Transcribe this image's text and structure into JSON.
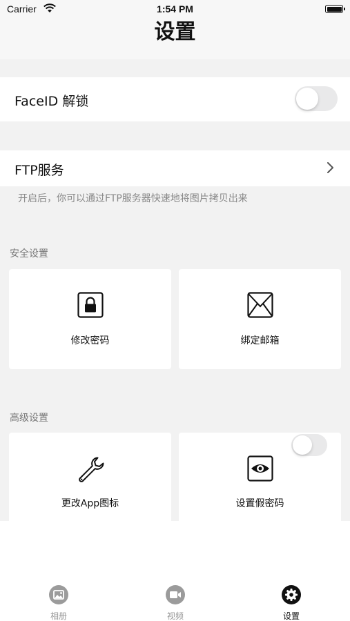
{
  "status_bar": {
    "carrier": "Carrier",
    "time": "1:54 PM"
  },
  "header": {
    "title": "设置"
  },
  "faceid": {
    "label": "FaceID 解锁",
    "enabled": false
  },
  "ftp": {
    "label": "FTP服务",
    "description": "开启后，你可以通过FTP服务器快速地将图片拷贝出来"
  },
  "security": {
    "section_title": "安全设置",
    "cards": [
      {
        "label": "修改密码",
        "icon": "lock-icon"
      },
      {
        "label": "绑定邮箱",
        "icon": "envelope-icon"
      }
    ]
  },
  "advanced": {
    "section_title": "高级设置",
    "cards": [
      {
        "label": "更改App图标",
        "icon": "wrench-icon"
      },
      {
        "label": "设置假密码",
        "icon": "eye-icon",
        "toggle_enabled": false
      }
    ]
  },
  "tabbar": {
    "items": [
      {
        "label": "相册",
        "icon": "photo-icon",
        "active": false
      },
      {
        "label": "视频",
        "icon": "video-icon",
        "active": false
      },
      {
        "label": "设置",
        "icon": "gear-icon",
        "active": true
      }
    ]
  },
  "colors": {
    "accent": "#111111",
    "toggle_off": "#e9e9ea",
    "inactive_tab": "#9b9b9b"
  }
}
